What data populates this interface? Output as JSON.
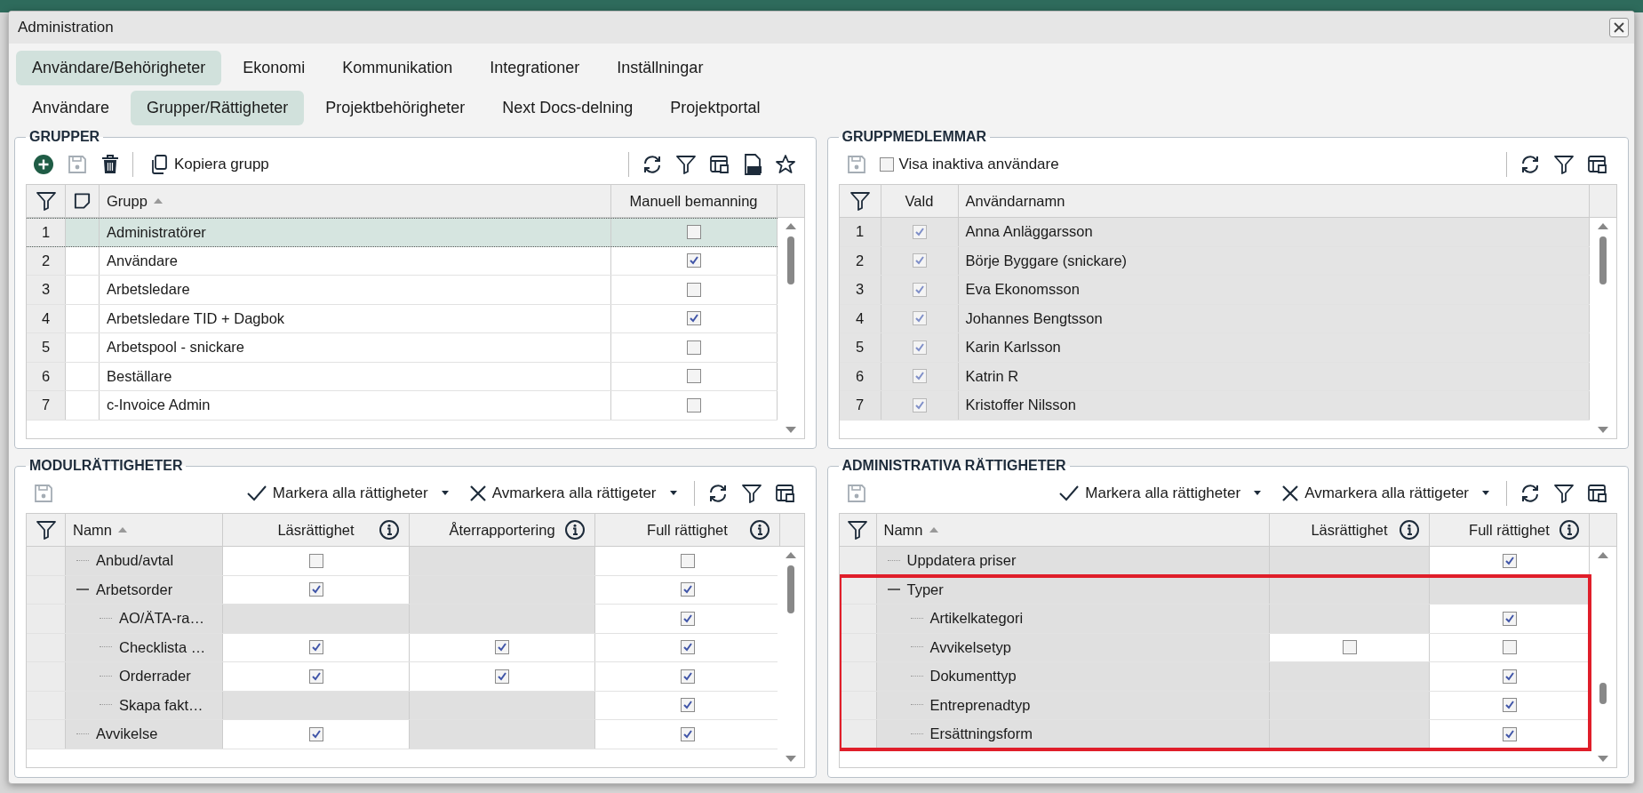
{
  "window": {
    "title": "Administration"
  },
  "tabs": [
    {
      "label": "Användare/Behörigheter",
      "selected": true
    },
    {
      "label": "Ekonomi",
      "selected": false
    },
    {
      "label": "Kommunikation",
      "selected": false
    },
    {
      "label": "Integrationer",
      "selected": false
    },
    {
      "label": "Inställningar",
      "selected": false
    }
  ],
  "subtabs": [
    {
      "label": "Användare",
      "selected": false
    },
    {
      "label": "Grupper/Rättigheter",
      "selected": true
    },
    {
      "label": "Projektbehörigheter",
      "selected": false
    },
    {
      "label": "Next Docs-delning",
      "selected": false
    },
    {
      "label": "Projektportal",
      "selected": false
    }
  ],
  "groups_panel": {
    "title": "GRUPPER",
    "copy_label": "Kopiera grupp",
    "columns": [
      "Grupp",
      "Manuell bemanning"
    ],
    "rows": [
      {
        "number": "1",
        "name": "Administratörer",
        "manual_staffing": false,
        "selected": true
      },
      {
        "number": "2",
        "name": "Användare",
        "manual_staffing": true,
        "selected": false
      },
      {
        "number": "3",
        "name": "Arbetsledare",
        "manual_staffing": false,
        "selected": false
      },
      {
        "number": "4",
        "name": "Arbetsledare TID + Dagbok",
        "manual_staffing": true,
        "selected": false
      },
      {
        "number": "5",
        "name": "Arbetspool - snickare",
        "manual_staffing": false,
        "selected": false
      },
      {
        "number": "6",
        "name": "Beställare",
        "manual_staffing": false,
        "selected": false
      },
      {
        "number": "7",
        "name": "c-Invoice Admin",
        "manual_staffing": false,
        "selected": false
      }
    ]
  },
  "members_panel": {
    "title": "GRUPPMEDLEMMAR",
    "show_inactive": {
      "label": "Visa inaktiva användare",
      "checked": false
    },
    "columns": [
      "Vald",
      "Användarnamn"
    ],
    "rows": [
      {
        "number": "1",
        "chosen": true,
        "name": "Anna Anläggarsson"
      },
      {
        "number": "2",
        "chosen": true,
        "name": "Börje Byggare (snickare)"
      },
      {
        "number": "3",
        "chosen": true,
        "name": "Eva Ekonomsson"
      },
      {
        "number": "4",
        "chosen": true,
        "name": "Johannes Bengtsson"
      },
      {
        "number": "5",
        "chosen": true,
        "name": "Karin Karlsson"
      },
      {
        "number": "6",
        "chosen": true,
        "name": "Katrin R"
      },
      {
        "number": "7",
        "chosen": true,
        "name": "Kristoffer Nilsson"
      }
    ]
  },
  "module_panel": {
    "title": "MODULRÄTTIGHETER",
    "mark_all": "Markera alla rättigheter",
    "unmark_all": "Avmarkera alla rättigeter",
    "columns": [
      "Namn",
      "Läsrättighet",
      "Återrapportering",
      "Full rättighet"
    ],
    "rows": [
      {
        "name": "Anbud/avtal",
        "cells": [
          {
            "kind": "check",
            "checked": false
          },
          {
            "kind": "none"
          },
          {
            "kind": "check",
            "checked": false
          }
        ]
      },
      {
        "name": "Arbetsorder",
        "expanded": true,
        "cells": [
          {
            "kind": "check",
            "checked": true
          },
          {
            "kind": "none"
          },
          {
            "kind": "check",
            "checked": true
          }
        ],
        "children": [
          {
            "name": "AO/ÄTA-ra…",
            "cells": [
              {
                "kind": "none"
              },
              {
                "kind": "none"
              },
              {
                "kind": "check",
                "checked": true
              }
            ]
          },
          {
            "name": "Checklista …",
            "cells": [
              {
                "kind": "check",
                "checked": true
              },
              {
                "kind": "check",
                "checked": true
              },
              {
                "kind": "check",
                "checked": true
              }
            ]
          },
          {
            "name": "Orderrader",
            "cells": [
              {
                "kind": "check",
                "checked": true
              },
              {
                "kind": "check",
                "checked": true
              },
              {
                "kind": "check",
                "checked": true
              }
            ]
          },
          {
            "name": "Skapa fakt…",
            "cells": [
              {
                "kind": "none"
              },
              {
                "kind": "none"
              },
              {
                "kind": "check",
                "checked": true
              }
            ]
          }
        ]
      },
      {
        "name": "Avvikelse",
        "cells": [
          {
            "kind": "check",
            "checked": true
          },
          {
            "kind": "none"
          },
          {
            "kind": "check",
            "checked": true
          }
        ]
      }
    ]
  },
  "admin_panel": {
    "title": "ADMINISTRATIVA RÄTTIGHETER",
    "mark_all": "Markera alla rättigheter",
    "unmark_all": "Avmarkera alla rättigeter",
    "columns": [
      "Namn",
      "Läsrättighet",
      "Full rättighet"
    ],
    "rows": [
      {
        "name": "Uppdatera priser",
        "cells": [
          {
            "kind": "none"
          },
          {
            "kind": "check",
            "checked": true
          }
        ]
      },
      {
        "name": "Typer",
        "expanded": true,
        "highlighted": true,
        "cells": [
          {
            "kind": "none"
          },
          {
            "kind": "none"
          }
        ],
        "children": [
          {
            "name": "Artikelkategori",
            "cells": [
              {
                "kind": "none"
              },
              {
                "kind": "check",
                "checked": true
              }
            ]
          },
          {
            "name": "Avvikelsetyp",
            "cells": [
              {
                "kind": "check",
                "checked": false
              },
              {
                "kind": "check",
                "checked": false
              }
            ]
          },
          {
            "name": "Dokumenttyp",
            "cells": [
              {
                "kind": "none"
              },
              {
                "kind": "check",
                "checked": true
              }
            ]
          },
          {
            "name": "Entreprenadtyp",
            "cells": [
              {
                "kind": "none"
              },
              {
                "kind": "check",
                "checked": true
              }
            ]
          },
          {
            "name": "Ersättningsform",
            "cells": [
              {
                "kind": "none"
              },
              {
                "kind": "check",
                "checked": true
              }
            ]
          }
        ]
      }
    ]
  }
}
